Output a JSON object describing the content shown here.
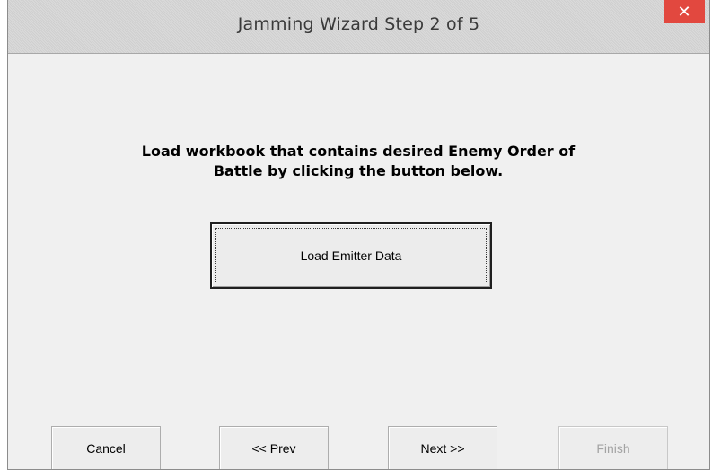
{
  "window": {
    "title": "Jamming Wizard Step 2 of 5",
    "close_label": "✕"
  },
  "main": {
    "message_line1": "Load workbook that contains desired Enemy Order of",
    "message_line2": "Battle by clicking the button below.",
    "load_button_label": "Load Emitter Data"
  },
  "nav": {
    "cancel_label": "Cancel",
    "prev_label": "<< Prev",
    "next_label": "Next >>",
    "finish_label": "Finish",
    "finish_disabled": true
  },
  "colors": {
    "close_button": "#e2483f",
    "window_background": "#f0f0f0",
    "titlebar": "#d6d6d6",
    "disabled_text": "#a3a3a3"
  },
  "icons": {
    "close": "close-icon"
  }
}
